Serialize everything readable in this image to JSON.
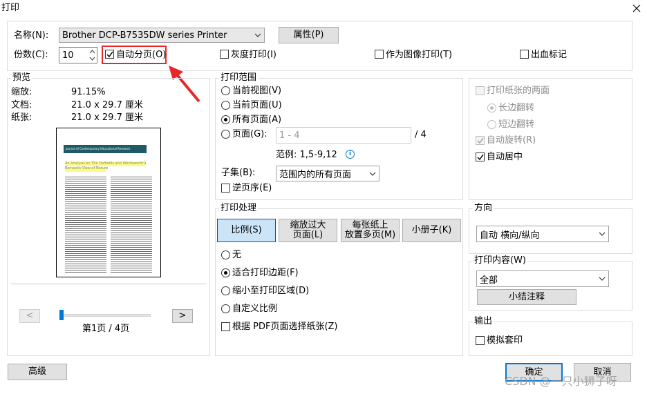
{
  "window": {
    "title": "打印"
  },
  "printer": {
    "name_label": "名称(N):",
    "name_value": "Brother DCP-B7535DW series Printer",
    "properties_button": "属性(P)",
    "copies_label": "份数(C):",
    "copies_value": "10",
    "collate_label": "自动分页(O)",
    "grayscale_label": "灰度打印(I)",
    "print_as_image_label": "作为图像打印(T)",
    "bleed_marks_label": "出血标记"
  },
  "preview": {
    "title": "预览",
    "zoom_label": "缩放:",
    "zoom_value": "91.15%",
    "document_label": "文档:",
    "document_value": "21.0 x 29.7 厘米",
    "paper_label": "纸张:",
    "paper_value": "21.0 x 29.7 厘米",
    "thumb_journal": "Journal of Contemporary Educational Research",
    "thumb_article_title": "An Analysis on The Daffodils and Wordsworth's Romantic View of Nature",
    "prev_button": "<",
    "next_button": ">",
    "page_indicator": "第1页 / 4页",
    "slider_position": 0.0
  },
  "print_range": {
    "title": "打印范围",
    "current_view": "当前视图(V)",
    "current_page": "当前页面(U)",
    "all_pages": "所有页面(A)",
    "pages": "页面(G):",
    "pages_placeholder": "1 - 4",
    "pages_total": "/ 4",
    "example": "范例: 1,5-9,12",
    "subset_label": "子集(B):",
    "subset_value": "范围内的所有页面",
    "reverse_label": "逆页序(E)"
  },
  "duplex": {
    "both_sides": "打印纸张的两面",
    "long_edge": "长边翻转",
    "short_edge": "短边翻转",
    "auto_rotate": "自动旋转(R)",
    "auto_center": "自动居中"
  },
  "handling": {
    "title": "打印处理",
    "tab_scale": "比例(S)",
    "tab_poster_l1": "缩放过大",
    "tab_poster_l2": "页面(L)",
    "tab_multiple_l1": "每张纸上",
    "tab_multiple_l2": "放置多页(M)",
    "tab_booklet": "小册子(K)",
    "opt_none": "无",
    "opt_fit_margins": "适合打印边距(F)",
    "opt_shrink": "缩小至打印区域(D)",
    "opt_custom": "自定义比例",
    "choose_paper_by_pdf": "根据 PDF页面选择纸张(Z)"
  },
  "orientation": {
    "title": "方向",
    "value": "自动 横向/纵向"
  },
  "content": {
    "title": "打印内容(W)",
    "value": "全部",
    "summarize_button": "小结注释"
  },
  "output": {
    "title": "输出",
    "simulate_overprint": "模拟套印"
  },
  "footer": {
    "advanced_button": "高级",
    "ok_button": "确定",
    "cancel_button": "取消",
    "watermark": "CSDN @一只小狮子呀"
  },
  "colors": {
    "highlight_box": "#e8262a",
    "selected_tab": "#cce4f7",
    "accent_border": "#0078d7"
  }
}
